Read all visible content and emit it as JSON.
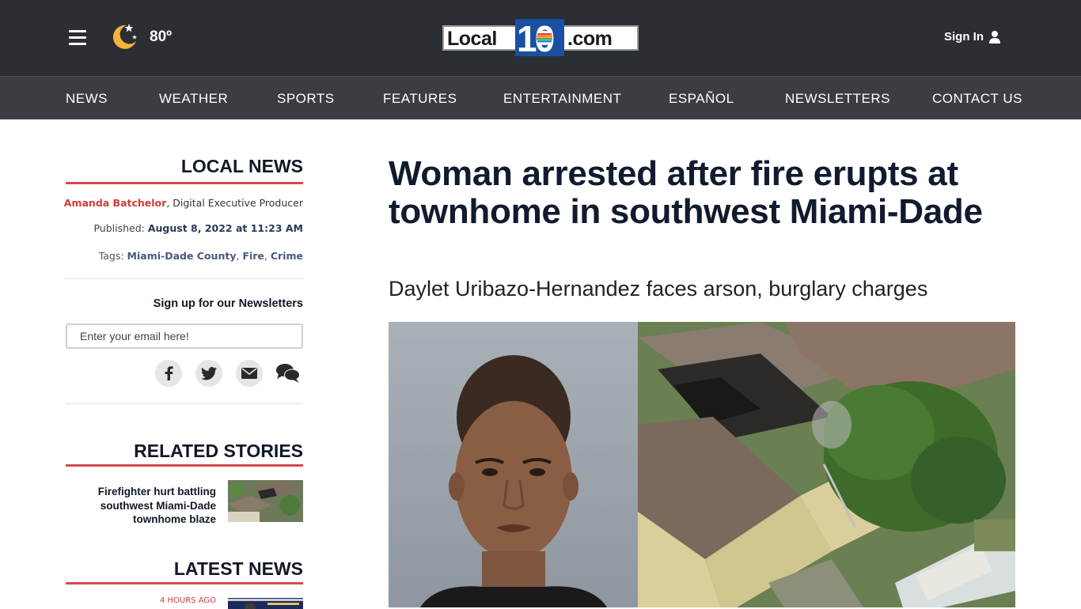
{
  "header": {
    "temperature": "80º",
    "logo": {
      "left": "Local",
      "mid": "10",
      "right": ".com"
    },
    "sign_in": "Sign In"
  },
  "nav": {
    "items": [
      "NEWS",
      "WEATHER",
      "SPORTS",
      "FEATURES",
      "ENTERTAINMENT",
      "ESPAÑOL",
      "NEWSLETTERS",
      "CONTACT US"
    ]
  },
  "sidebar": {
    "section_title": "LOCAL NEWS",
    "author": "Amanda Batchelor",
    "author_role": ", Digital Executive Producer",
    "published_label": "Published: ",
    "published_date": "August 8, 2022 at 11:23 AM",
    "tags_label": "Tags: ",
    "tags": [
      "Miami-Dade County",
      "Fire",
      "Crime"
    ],
    "newsletter_label": "Sign up for our Newsletters",
    "email_placeholder": "Enter your email here!",
    "related_heading": "RELATED STORIES",
    "related_title": "Firefighter hurt battling southwest Miami-Dade townhome blaze",
    "latest_heading": "LATEST NEWS",
    "latest_time": "4 HOURS AGO"
  },
  "article": {
    "headline": "Woman arrested after fire erupts at townhome in southwest Miami-Dade",
    "subheadline": "Daylet Uribazo-Hernandez faces arson, burglary charges"
  },
  "colors": {
    "topbar": "#2b2e33",
    "navbar": "#3a3d42",
    "accent_red": "#d94a4a",
    "headline": "#111a2e"
  }
}
